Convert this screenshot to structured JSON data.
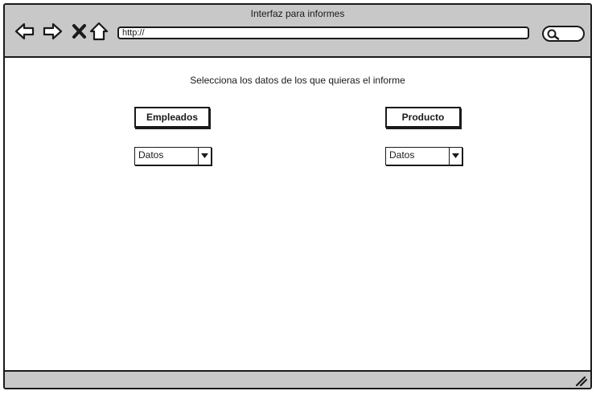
{
  "window": {
    "title": "Interfaz para informes"
  },
  "toolbar": {
    "url": "http://",
    "icons": [
      "back-arrow-icon",
      "forward-arrow-icon",
      "close-icon",
      "home-icon",
      "search-icon"
    ]
  },
  "main": {
    "instruction": "Selecciona los datos de los que quieras el informe",
    "left": {
      "button_label": "Empleados",
      "select_value": "Datos"
    },
    "right": {
      "button_label": "Producto",
      "select_value": "Datos"
    }
  },
  "colors": {
    "chrome": "#c8c8c8",
    "ink": "#1a1a1a",
    "background": "#ffffff"
  }
}
